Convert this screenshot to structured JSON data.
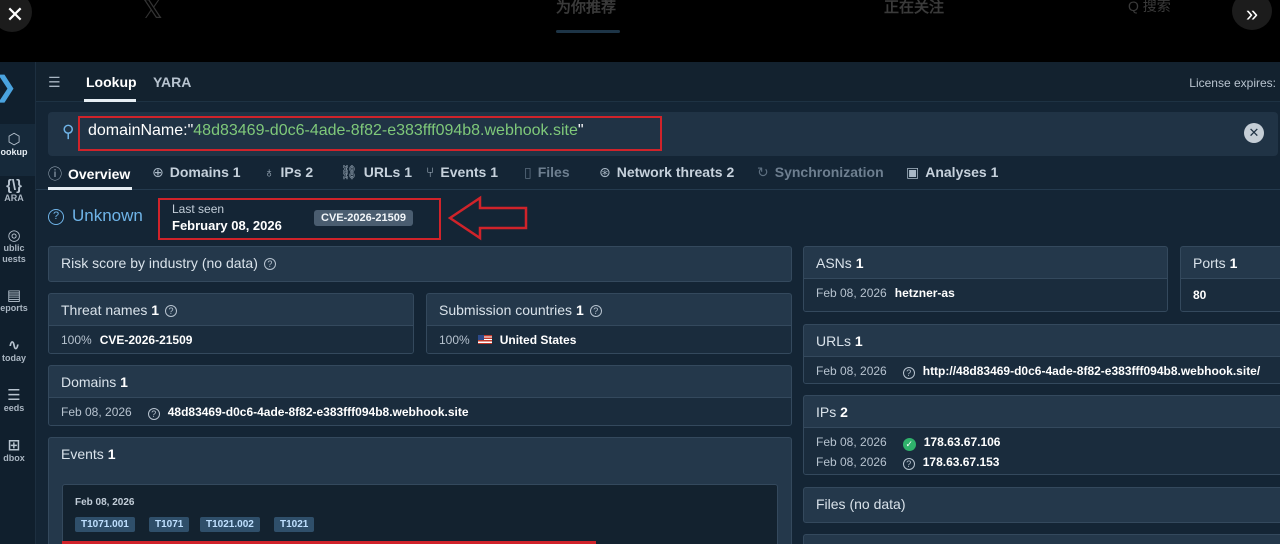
{
  "host": {
    "tabs": [
      "为你推荐",
      "正在关注"
    ],
    "search_label": "Q 搜索"
  },
  "topnav": {
    "tabs": [
      "Lookup",
      "YARA"
    ],
    "license_label": "License expires:"
  },
  "rail": {
    "items": [
      "ookup",
      "ARA",
      "ublic uests",
      "eports",
      "today",
      "eeds",
      "dbox"
    ]
  },
  "search": {
    "key": "domainName:\"",
    "value": "48d83469-d0c6-4ade-8f82-e383fff094b8.webhook.site",
    "suffix": "\""
  },
  "subtabs": [
    {
      "label": "Overview",
      "count": ""
    },
    {
      "label": "Domains",
      "count": "1"
    },
    {
      "label": "IPs",
      "count": "2"
    },
    {
      "label": "URLs",
      "count": "1"
    },
    {
      "label": "Events",
      "count": "1"
    },
    {
      "label": "Files",
      "count": ""
    },
    {
      "label": "Network threats",
      "count": "2"
    },
    {
      "label": "Synchronization",
      "count": ""
    },
    {
      "label": "Analyses",
      "count": "1"
    }
  ],
  "status": {
    "verdict": "Unknown",
    "last_seen_label": "Last seen",
    "last_seen_date": "February 08, 2026",
    "cve_chip": "CVE-2026-21509"
  },
  "cards": {
    "risk": {
      "title": "Risk score by industry (no data)"
    },
    "threat_names": {
      "title": "Threat names",
      "count": "1",
      "pct": "100%",
      "value": "CVE-2026-21509"
    },
    "submission_countries": {
      "title": "Submission countries",
      "count": "1",
      "pct": "100%",
      "value": "United States"
    },
    "domains": {
      "title": "Domains",
      "count": "1",
      "date": "Feb 08, 2026",
      "value": "48d83469-d0c6-4ade-8f82-e383fff094b8.webhook.site"
    },
    "events": {
      "title": "Events",
      "count": "1",
      "date": "Feb 08, 2026",
      "tags": [
        "T1071.001",
        "T1071",
        "T1021.002",
        "T1021"
      ]
    },
    "asns": {
      "title": "ASNs",
      "count": "1",
      "date": "Feb 08, 2026",
      "value": "hetzner-as"
    },
    "ports": {
      "title": "Ports",
      "count": "1",
      "value": "80"
    },
    "urls": {
      "title": "URLs",
      "count": "1",
      "date": "Feb 08, 2026",
      "value": "http://48d83469-d0c6-4ade-8f82-e383fff094b8.webhook.site/"
    },
    "ips": {
      "title": "IPs",
      "count": "2",
      "rows": [
        {
          "date": "Feb 08, 2026",
          "value": "178.63.67.106",
          "status": "clean"
        },
        {
          "date": "Feb 08, 2026",
          "value": "178.63.67.153",
          "status": "unknown"
        }
      ]
    },
    "files": {
      "title": "Files (no data)"
    }
  },
  "colors": {
    "accent": "#6fb4e8",
    "highlight": "#d0232a",
    "query_value": "#7fc97a",
    "clean": "#2fb26b"
  }
}
